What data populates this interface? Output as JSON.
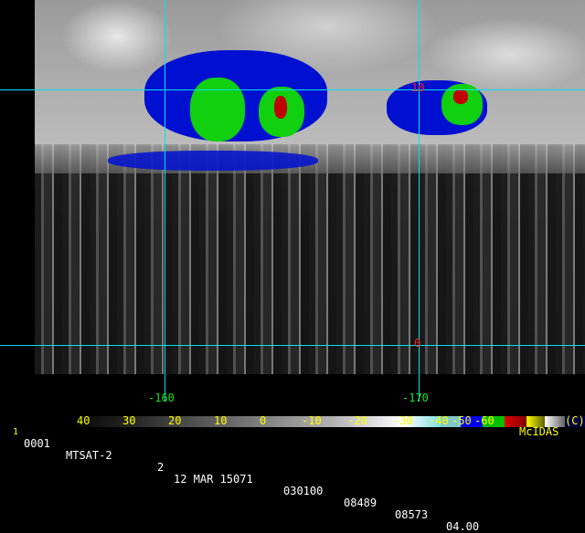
{
  "header": {
    "frame_marker": "1",
    "frame": "0001",
    "satellite": "MTSAT-2",
    "band": "2",
    "date": "12 MAR 15071",
    "time": "030100",
    "line": "08489",
    "element": "08573",
    "resolution": "04.00",
    "software": "McIDAS"
  },
  "grid": {
    "lat_labels": [
      "10",
      "0"
    ],
    "lon_labels": [
      "-160",
      "-170"
    ],
    "line_color": "#00e0f0"
  },
  "colorbar": {
    "unit_label": "(C)",
    "ticks": [
      "40",
      "30",
      "20",
      "10",
      "0",
      "-10",
      "-20",
      "-30",
      "-40",
      "-50",
      "-60"
    ],
    "colors": [
      "#000000",
      "#404040",
      "#808080",
      "#c0c0c0",
      "#ffffff",
      "#7fe0e0",
      "#0000ff",
      "#00c000",
      "#c00000",
      "#ffff00",
      "#ffffff",
      "#000040"
    ]
  }
}
